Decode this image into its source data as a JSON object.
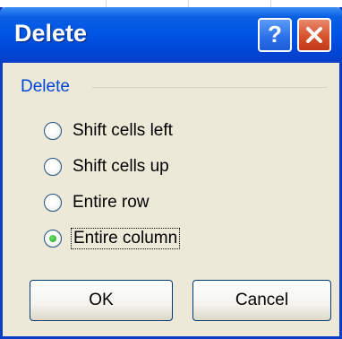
{
  "dialog": {
    "title": "Delete",
    "help_symbol": "?",
    "icons": [
      "help-icon",
      "close-icon"
    ],
    "colors": {
      "titlebar": "#0054e3",
      "body": "#ece9d8",
      "group_label": "#0046d5",
      "close": "#d44f2a"
    }
  },
  "group": {
    "label": "Delete",
    "options": [
      {
        "label": "Shift cells left",
        "selected": false
      },
      {
        "label": "Shift cells up",
        "selected": false
      },
      {
        "label": "Entire row",
        "selected": false
      },
      {
        "label": "Entire column",
        "selected": true
      }
    ]
  },
  "buttons": {
    "ok": "OK",
    "cancel": "Cancel"
  }
}
